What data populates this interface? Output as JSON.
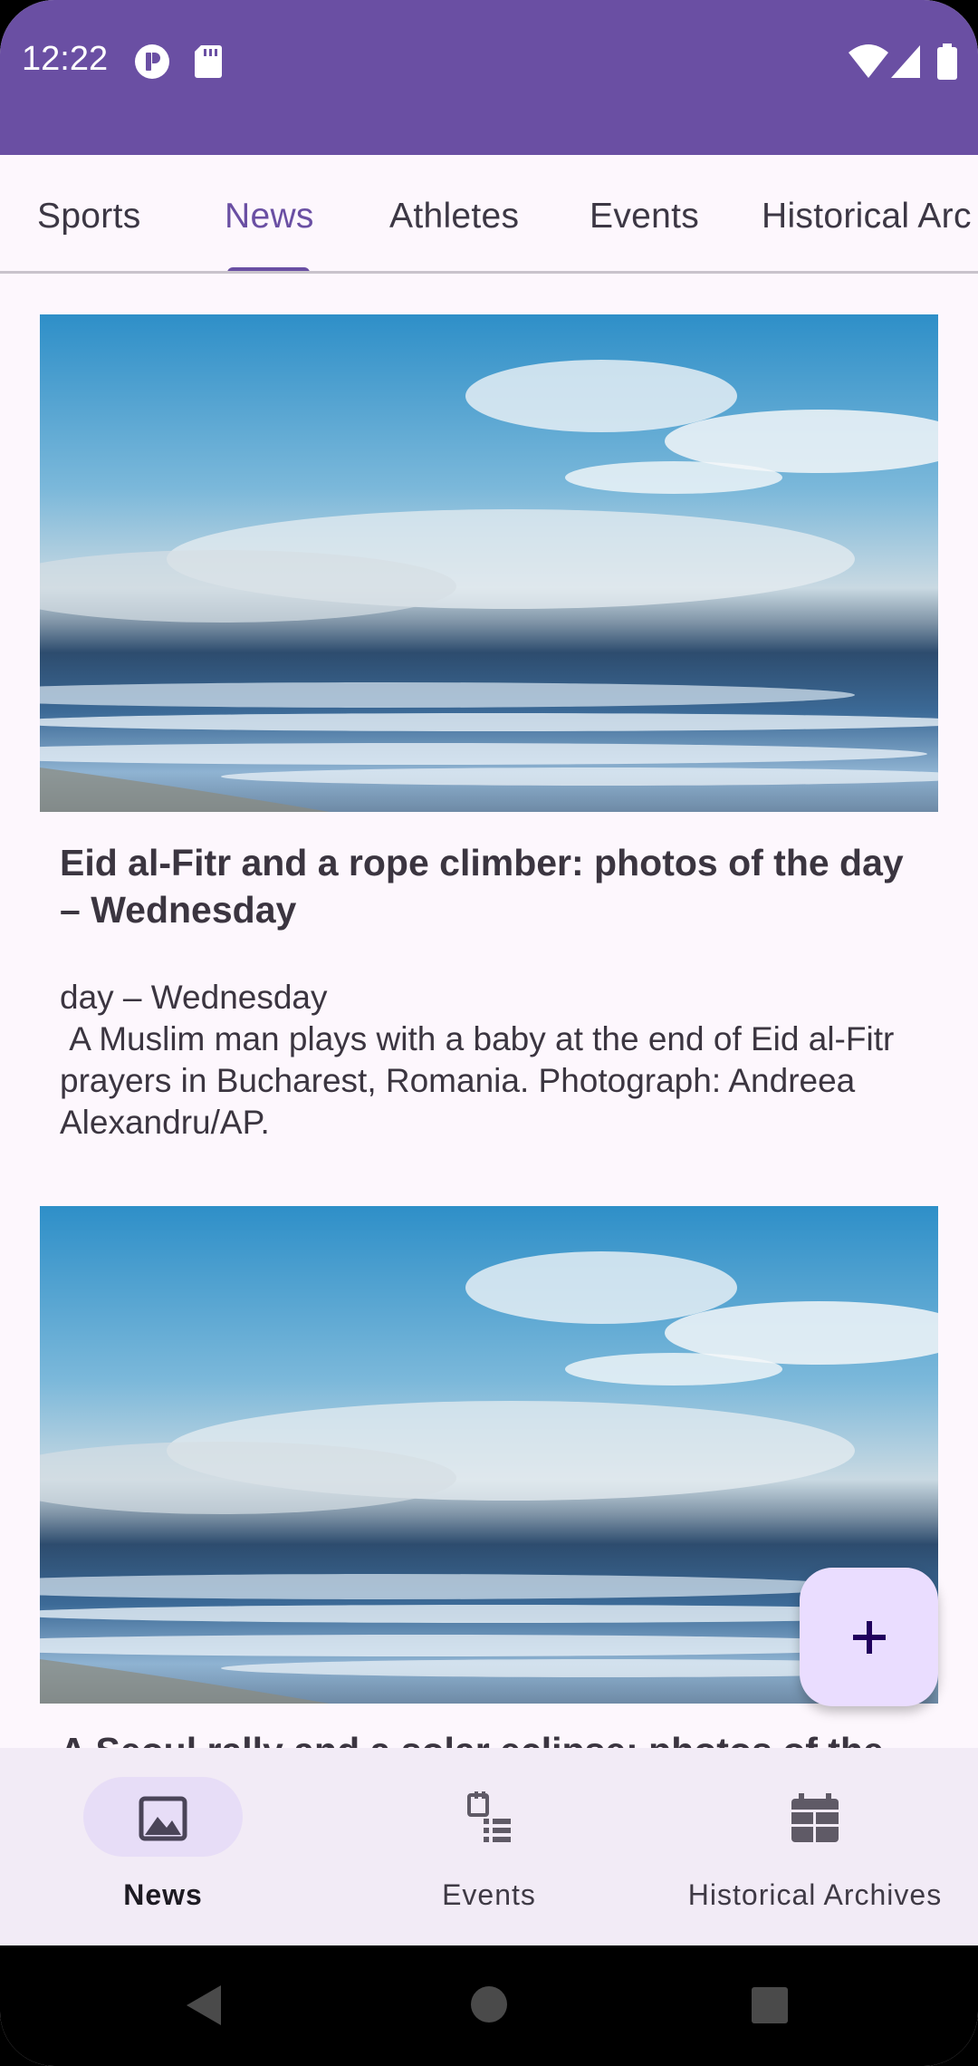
{
  "status_bar": {
    "time": "12:22",
    "background": "#6A4FA3",
    "left_icons": [
      "p-circle-icon",
      "sd-card-icon"
    ],
    "right_icons": [
      "wifi-icon",
      "cell-signal-icon",
      "battery-icon"
    ]
  },
  "tabs": {
    "items": [
      {
        "label": "Sports",
        "active": false
      },
      {
        "label": "News",
        "active": true
      },
      {
        "label": "Athletes",
        "active": false
      },
      {
        "label": "Events",
        "active": false
      },
      {
        "label": "Historical Arc",
        "active": false
      }
    ],
    "accent": "#6A4FA3"
  },
  "articles": [
    {
      "image": "ocean-beach-photo",
      "title": "Eid al-Fitr and a rope climber: photos of the day – Wednesday",
      "body": "day – Wednesday\n A Muslim man plays with a baby at the end of Eid al-Fitr prayers in Bucharest, Romania. Photograph: Andreea Alexandru/AP."
    },
    {
      "image": "ocean-beach-photo",
      "title": "A Seoul rally and a solar eclipse: photos of the",
      "body": ""
    }
  ],
  "fab": {
    "icon": "plus-icon",
    "background": "#EADDFF"
  },
  "bottom_nav": {
    "items": [
      {
        "label": "News",
        "icon": "image-icon",
        "active": true
      },
      {
        "label": "Events",
        "icon": "event-list-icon",
        "active": false
      },
      {
        "label": "Historical Archives",
        "icon": "calendar-grid-icon",
        "active": false
      }
    ]
  },
  "system_nav": {
    "icons": [
      "back-icon",
      "home-icon",
      "recents-icon"
    ]
  }
}
